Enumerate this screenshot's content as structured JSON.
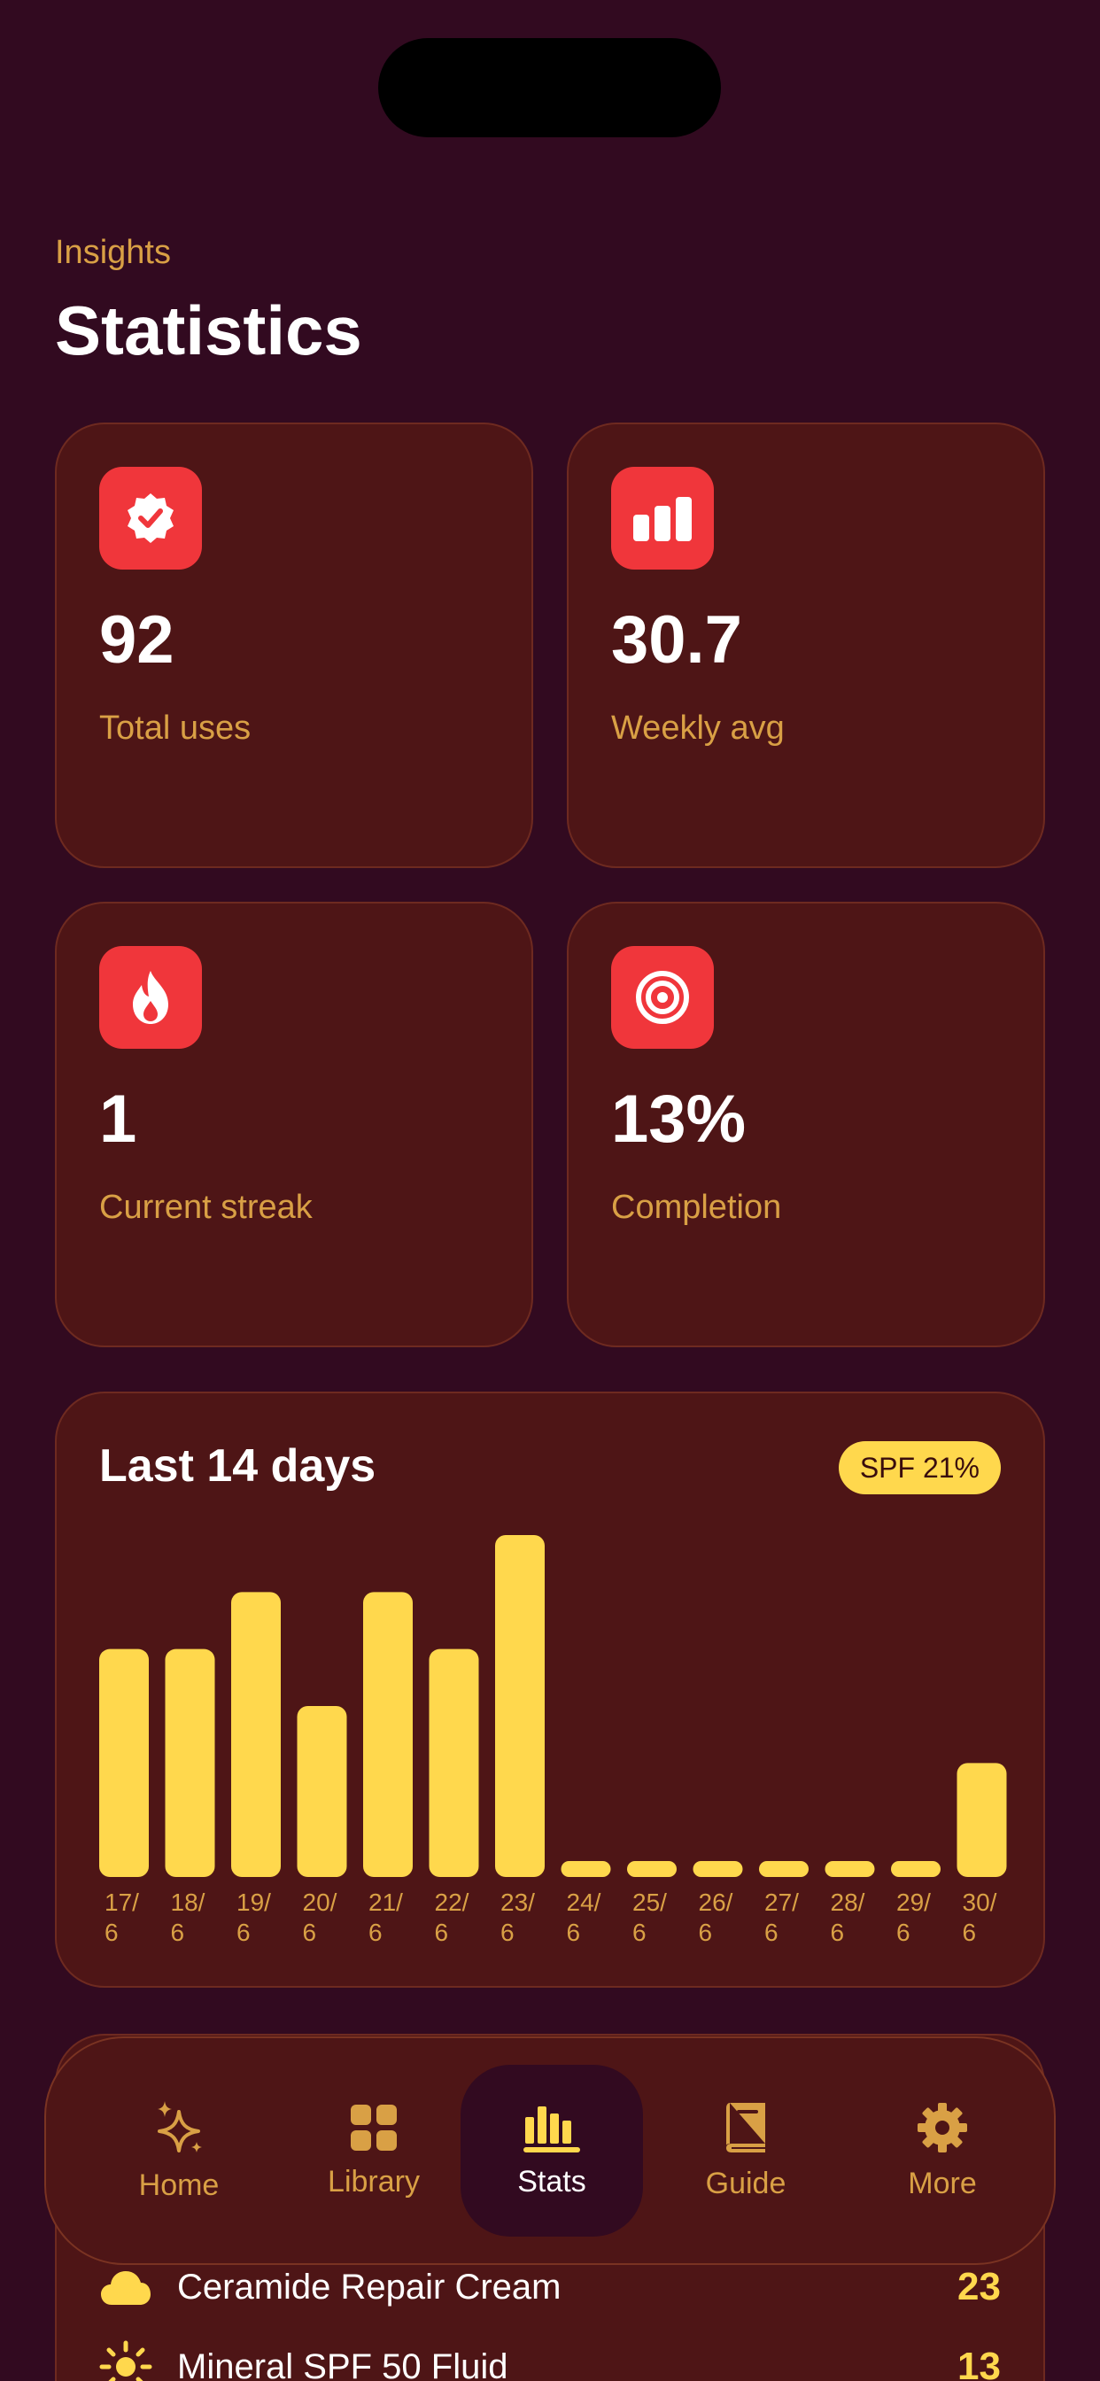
{
  "header": {
    "kicker": "Insights",
    "title": "Statistics"
  },
  "stats": [
    {
      "icon": "verified-badge-icon",
      "value": "92",
      "label": "Total uses"
    },
    {
      "icon": "bar-chart-icon",
      "value": "30.7",
      "label": "Weekly avg"
    },
    {
      "icon": "flame-icon",
      "value": "1",
      "label": "Current streak"
    },
    {
      "icon": "target-icon",
      "value": "13%",
      "label": "Completion"
    }
  ],
  "chart_data": {
    "type": "bar",
    "title": "Last 14 days",
    "badge": "SPF 21%",
    "categories": [
      "17/6",
      "18/6",
      "19/6",
      "20/6",
      "21/6",
      "22/6",
      "23/6",
      "24/6",
      "25/6",
      "26/6",
      "27/6",
      "28/6",
      "29/6",
      "30/6"
    ],
    "values": [
      8,
      8,
      10,
      6,
      10,
      8,
      12,
      0,
      0,
      0,
      0,
      0,
      0,
      4
    ],
    "ylim": [
      0,
      12
    ],
    "grid": false,
    "bar_color": "#ffd84d"
  },
  "list": {
    "items": [
      {
        "icon": "cloud-icon",
        "name": "Ceramide Repair Cream",
        "count": "23"
      },
      {
        "icon": "sun-icon",
        "name": "Mineral SPF 50 Fluid",
        "count": "13"
      }
    ]
  },
  "tabbar": {
    "items": [
      {
        "icon": "sparkles-icon",
        "label": "Home"
      },
      {
        "icon": "grid-icon",
        "label": "Library"
      },
      {
        "icon": "stats-icon",
        "label": "Stats"
      },
      {
        "icon": "book-icon",
        "label": "Guide"
      },
      {
        "icon": "gear-icon",
        "label": "More"
      }
    ],
    "active": "Stats"
  },
  "colors": {
    "background": "#320a20",
    "card": "#4e1516",
    "accent": "#ffd84d",
    "icon_bg": "#f0363b",
    "muted_text": "#d9a045"
  }
}
